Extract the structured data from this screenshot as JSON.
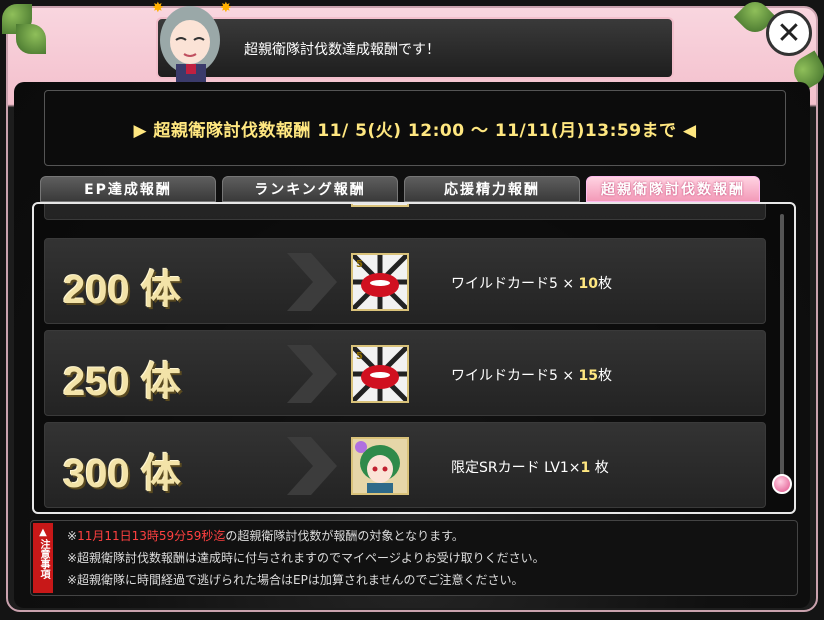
{
  "header": {
    "message": "超親衛隊討伐数達成報酬です！",
    "close_label": "✕"
  },
  "period": {
    "text": "▶ 超親衛隊討伐数報酬 11/ 5(火) 12:00 ～ 11/11(月)13:59まで ◀"
  },
  "tabs": [
    {
      "label": "EP達成報酬",
      "active": false
    },
    {
      "label": "ランキング報酬",
      "active": false
    },
    {
      "label": "応援精力報酬",
      "active": false
    },
    {
      "label": "超親衛隊討伐数報酬",
      "active": true
    }
  ],
  "rewards": [
    {
      "count": "200 体",
      "item_prefix": "ワイルドカード5 × ",
      "qty": "10",
      "item_suffix": "枚",
      "icon": "wildcard-lips-icon",
      "icon_badge": "5"
    },
    {
      "count": "250 体",
      "item_prefix": "ワイルドカード5 × ",
      "qty": "15",
      "item_suffix": "枚",
      "icon": "wildcard-lips-icon",
      "icon_badge": "5"
    },
    {
      "count": "300 体",
      "item_prefix": "限定SRカード LV1×",
      "qty": "1",
      "item_suffix": " 枚",
      "icon": "sr-card-character-icon",
      "icon_badge": ""
    }
  ],
  "notes": {
    "badge": "注意事項",
    "line1_red": "11月11日13時59分59秒迄",
    "line1_rest": "の超親衛隊討伐数が報酬の対象となります。",
    "line2": "※超親衛隊討伐数報酬は達成時に付与されますのでマイページよりお受け取りください。",
    "line3": "※超親衛隊に時間経過で逃げられた場合はEPは加算されませんのでご注意ください。",
    "line1_prefix": "※"
  },
  "colors": {
    "accent_pink": "#f39ab8",
    "gold_text": "#ffe780",
    "warning_red": "#ff4040"
  }
}
